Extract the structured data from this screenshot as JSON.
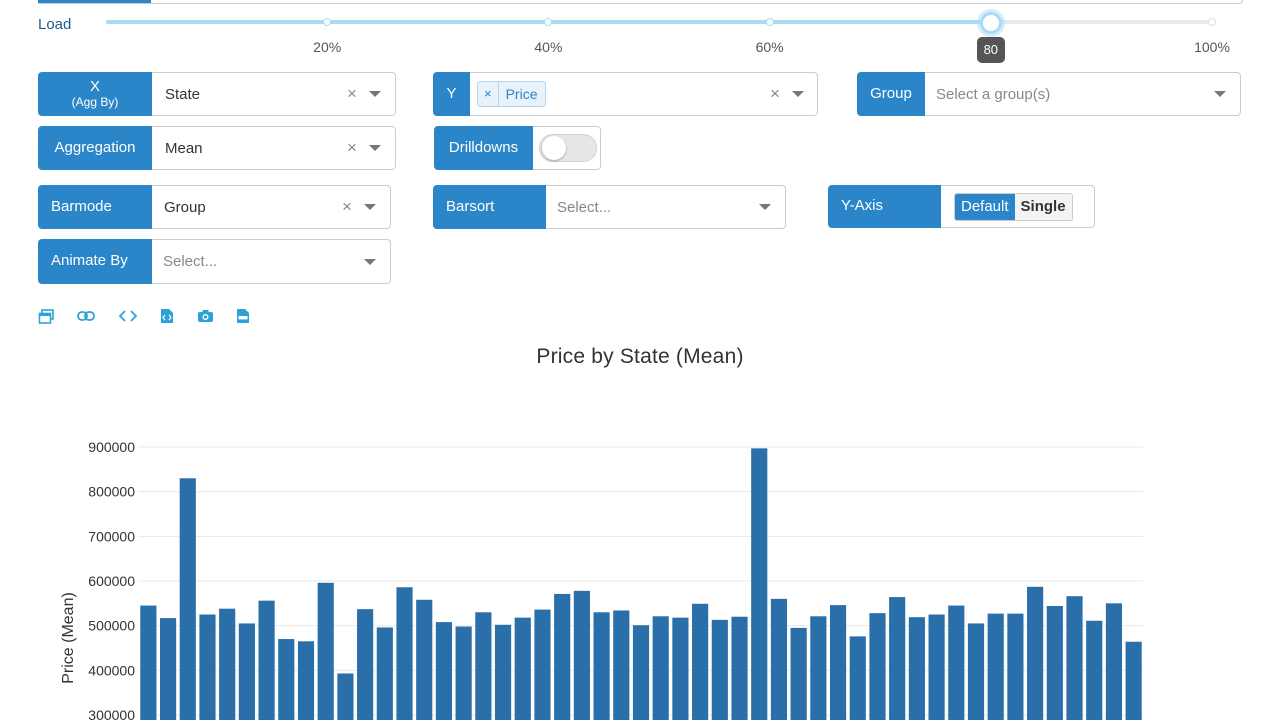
{
  "slider": {
    "label": "Load",
    "marks": [
      "20%",
      "40%",
      "60%",
      "80%",
      "100%"
    ],
    "value_fraction": 0.8,
    "tooltip": "80",
    "colors": {
      "fill": "#a9dcf4",
      "track": "#e9e9e9"
    }
  },
  "controls": {
    "x": {
      "label": "X",
      "sublabel": "(Agg By)",
      "value": "State",
      "clear": "×"
    },
    "y": {
      "label": "Y",
      "chip_remove": "×",
      "chip": "Price",
      "clear": "×"
    },
    "group": {
      "label": "Group",
      "placeholder": "Select a group(s)"
    },
    "aggregation": {
      "label": "Aggregation",
      "value": "Mean",
      "clear": "×"
    },
    "drilldowns": {
      "label": "Drilldowns",
      "enabled": false
    },
    "barmode": {
      "label": "Barmode",
      "value": "Group",
      "clear": "×"
    },
    "barsort": {
      "label": "Barsort",
      "placeholder": "Select..."
    },
    "yaxis": {
      "label": "Y-Axis",
      "options": [
        "Default",
        "Single"
      ],
      "selected": "Default"
    },
    "animate": {
      "label": "Animate By",
      "placeholder": "Select..."
    },
    "accent": "#2a86c8"
  },
  "toolbar": {
    "icons": [
      "popup-icon",
      "link-icon",
      "code-icon",
      "code-export-icon",
      "camera-icon",
      "csv-icon"
    ]
  },
  "chart_data": {
    "type": "bar",
    "title": "Price by State (Mean)",
    "xlabel": "",
    "ylabel": "Price (Mean)",
    "yticks": [
      "900000",
      "800000",
      "700000",
      "600000",
      "500000",
      "400000",
      "300000"
    ],
    "ylim": [
      300000,
      900000
    ],
    "grid": true,
    "color": "#2a6faa",
    "values": [
      545000,
      517000,
      830000,
      525000,
      538000,
      505000,
      556000,
      470000,
      465000,
      596000,
      393000,
      537000,
      496000,
      586000,
      558000,
      508000,
      498000,
      530000,
      502000,
      518000,
      536000,
      571000,
      578000,
      530000,
      534000,
      501000,
      521000,
      518000,
      549000,
      513000,
      520000,
      897000,
      560000,
      495000,
      521000,
      546000,
      476000,
      528000,
      564000,
      519000,
      525000,
      545000,
      505000,
      527000,
      527000,
      587000,
      544000,
      566000,
      511000,
      550000,
      464000
    ]
  }
}
